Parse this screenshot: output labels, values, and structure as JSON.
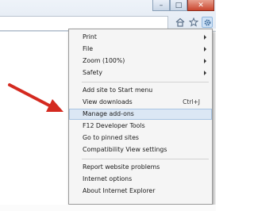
{
  "window_buttons": {
    "minimize": "–",
    "maximize": "□",
    "close": "✕"
  },
  "toolbar": {
    "icons": [
      "home-icon",
      "star-icon",
      "gear-icon"
    ]
  },
  "colors": {
    "highlight": "#dbe7f4",
    "arrow": "#d42a20"
  },
  "menu": {
    "items": [
      {
        "label": "Print",
        "submenu": true
      },
      {
        "label": "File",
        "submenu": true
      },
      {
        "label": "Zoom (100%)",
        "submenu": true
      },
      {
        "label": "Safety",
        "submenu": true
      },
      {
        "label": "Add site to Start menu"
      },
      {
        "label": "View downloads",
        "shortcut": "Ctrl+J"
      },
      {
        "label": "Manage add-ons",
        "highlighted": true
      },
      {
        "label": "F12 Developer Tools"
      },
      {
        "label": "Go to pinned sites"
      },
      {
        "label": "Compatibility View settings"
      },
      {
        "label": "Report website problems"
      },
      {
        "label": "Internet options"
      },
      {
        "label": "About Internet Explorer"
      }
    ]
  }
}
